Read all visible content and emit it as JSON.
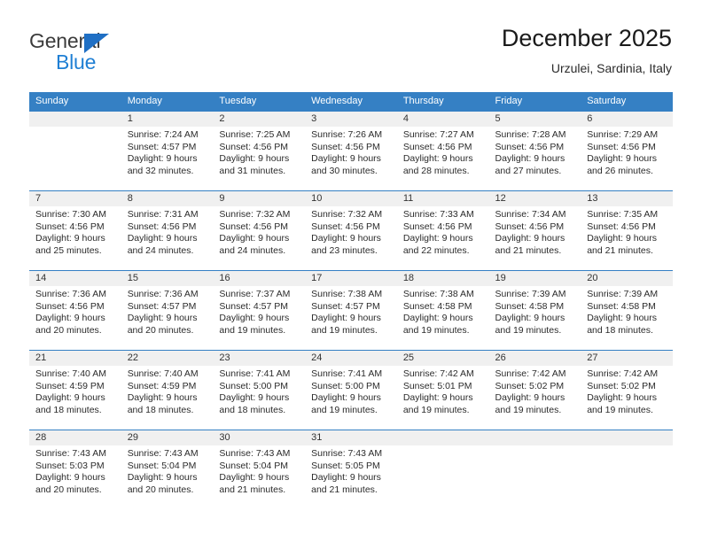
{
  "brand": {
    "name_top": "General",
    "name_bottom": "Blue",
    "accent_color": "#1f7fd4",
    "triangle_color": "#1f6fc4"
  },
  "header": {
    "title": "December 2025",
    "subtitle": "Urzulei, Sardinia, Italy"
  },
  "calendar": {
    "header_bg": "#3580c4",
    "header_text_color": "#ffffff",
    "daynum_band_bg": "#f0f0f0",
    "weekdays": [
      "Sunday",
      "Monday",
      "Tuesday",
      "Wednesday",
      "Thursday",
      "Friday",
      "Saturday"
    ],
    "weeks": [
      [
        {
          "day": "",
          "sunrise": "",
          "sunset": "",
          "daylight": "",
          "empty": true
        },
        {
          "day": "1",
          "sunrise": "Sunrise: 7:24 AM",
          "sunset": "Sunset: 4:57 PM",
          "daylight": "Daylight: 9 hours and 32 minutes."
        },
        {
          "day": "2",
          "sunrise": "Sunrise: 7:25 AM",
          "sunset": "Sunset: 4:56 PM",
          "daylight": "Daylight: 9 hours and 31 minutes."
        },
        {
          "day": "3",
          "sunrise": "Sunrise: 7:26 AM",
          "sunset": "Sunset: 4:56 PM",
          "daylight": "Daylight: 9 hours and 30 minutes."
        },
        {
          "day": "4",
          "sunrise": "Sunrise: 7:27 AM",
          "sunset": "Sunset: 4:56 PM",
          "daylight": "Daylight: 9 hours and 28 minutes."
        },
        {
          "day": "5",
          "sunrise": "Sunrise: 7:28 AM",
          "sunset": "Sunset: 4:56 PM",
          "daylight": "Daylight: 9 hours and 27 minutes."
        },
        {
          "day": "6",
          "sunrise": "Sunrise: 7:29 AM",
          "sunset": "Sunset: 4:56 PM",
          "daylight": "Daylight: 9 hours and 26 minutes."
        }
      ],
      [
        {
          "day": "7",
          "sunrise": "Sunrise: 7:30 AM",
          "sunset": "Sunset: 4:56 PM",
          "daylight": "Daylight: 9 hours and 25 minutes."
        },
        {
          "day": "8",
          "sunrise": "Sunrise: 7:31 AM",
          "sunset": "Sunset: 4:56 PM",
          "daylight": "Daylight: 9 hours and 24 minutes."
        },
        {
          "day": "9",
          "sunrise": "Sunrise: 7:32 AM",
          "sunset": "Sunset: 4:56 PM",
          "daylight": "Daylight: 9 hours and 24 minutes."
        },
        {
          "day": "10",
          "sunrise": "Sunrise: 7:32 AM",
          "sunset": "Sunset: 4:56 PM",
          "daylight": "Daylight: 9 hours and 23 minutes."
        },
        {
          "day": "11",
          "sunrise": "Sunrise: 7:33 AM",
          "sunset": "Sunset: 4:56 PM",
          "daylight": "Daylight: 9 hours and 22 minutes."
        },
        {
          "day": "12",
          "sunrise": "Sunrise: 7:34 AM",
          "sunset": "Sunset: 4:56 PM",
          "daylight": "Daylight: 9 hours and 21 minutes."
        },
        {
          "day": "13",
          "sunrise": "Sunrise: 7:35 AM",
          "sunset": "Sunset: 4:56 PM",
          "daylight": "Daylight: 9 hours and 21 minutes."
        }
      ],
      [
        {
          "day": "14",
          "sunrise": "Sunrise: 7:36 AM",
          "sunset": "Sunset: 4:56 PM",
          "daylight": "Daylight: 9 hours and 20 minutes."
        },
        {
          "day": "15",
          "sunrise": "Sunrise: 7:36 AM",
          "sunset": "Sunset: 4:57 PM",
          "daylight": "Daylight: 9 hours and 20 minutes."
        },
        {
          "day": "16",
          "sunrise": "Sunrise: 7:37 AM",
          "sunset": "Sunset: 4:57 PM",
          "daylight": "Daylight: 9 hours and 19 minutes."
        },
        {
          "day": "17",
          "sunrise": "Sunrise: 7:38 AM",
          "sunset": "Sunset: 4:57 PM",
          "daylight": "Daylight: 9 hours and 19 minutes."
        },
        {
          "day": "18",
          "sunrise": "Sunrise: 7:38 AM",
          "sunset": "Sunset: 4:58 PM",
          "daylight": "Daylight: 9 hours and 19 minutes."
        },
        {
          "day": "19",
          "sunrise": "Sunrise: 7:39 AM",
          "sunset": "Sunset: 4:58 PM",
          "daylight": "Daylight: 9 hours and 19 minutes."
        },
        {
          "day": "20",
          "sunrise": "Sunrise: 7:39 AM",
          "sunset": "Sunset: 4:58 PM",
          "daylight": "Daylight: 9 hours and 18 minutes."
        }
      ],
      [
        {
          "day": "21",
          "sunrise": "Sunrise: 7:40 AM",
          "sunset": "Sunset: 4:59 PM",
          "daylight": "Daylight: 9 hours and 18 minutes."
        },
        {
          "day": "22",
          "sunrise": "Sunrise: 7:40 AM",
          "sunset": "Sunset: 4:59 PM",
          "daylight": "Daylight: 9 hours and 18 minutes."
        },
        {
          "day": "23",
          "sunrise": "Sunrise: 7:41 AM",
          "sunset": "Sunset: 5:00 PM",
          "daylight": "Daylight: 9 hours and 18 minutes."
        },
        {
          "day": "24",
          "sunrise": "Sunrise: 7:41 AM",
          "sunset": "Sunset: 5:00 PM",
          "daylight": "Daylight: 9 hours and 19 minutes."
        },
        {
          "day": "25",
          "sunrise": "Sunrise: 7:42 AM",
          "sunset": "Sunset: 5:01 PM",
          "daylight": "Daylight: 9 hours and 19 minutes."
        },
        {
          "day": "26",
          "sunrise": "Sunrise: 7:42 AM",
          "sunset": "Sunset: 5:02 PM",
          "daylight": "Daylight: 9 hours and 19 minutes."
        },
        {
          "day": "27",
          "sunrise": "Sunrise: 7:42 AM",
          "sunset": "Sunset: 5:02 PM",
          "daylight": "Daylight: 9 hours and 19 minutes."
        }
      ],
      [
        {
          "day": "28",
          "sunrise": "Sunrise: 7:43 AM",
          "sunset": "Sunset: 5:03 PM",
          "daylight": "Daylight: 9 hours and 20 minutes."
        },
        {
          "day": "29",
          "sunrise": "Sunrise: 7:43 AM",
          "sunset": "Sunset: 5:04 PM",
          "daylight": "Daylight: 9 hours and 20 minutes."
        },
        {
          "day": "30",
          "sunrise": "Sunrise: 7:43 AM",
          "sunset": "Sunset: 5:04 PM",
          "daylight": "Daylight: 9 hours and 21 minutes."
        },
        {
          "day": "31",
          "sunrise": "Sunrise: 7:43 AM",
          "sunset": "Sunset: 5:05 PM",
          "daylight": "Daylight: 9 hours and 21 minutes."
        },
        {
          "day": "",
          "sunrise": "",
          "sunset": "",
          "daylight": "",
          "empty": true
        },
        {
          "day": "",
          "sunrise": "",
          "sunset": "",
          "daylight": "",
          "empty": true
        },
        {
          "day": "",
          "sunrise": "",
          "sunset": "",
          "daylight": "",
          "empty": true
        }
      ]
    ]
  }
}
